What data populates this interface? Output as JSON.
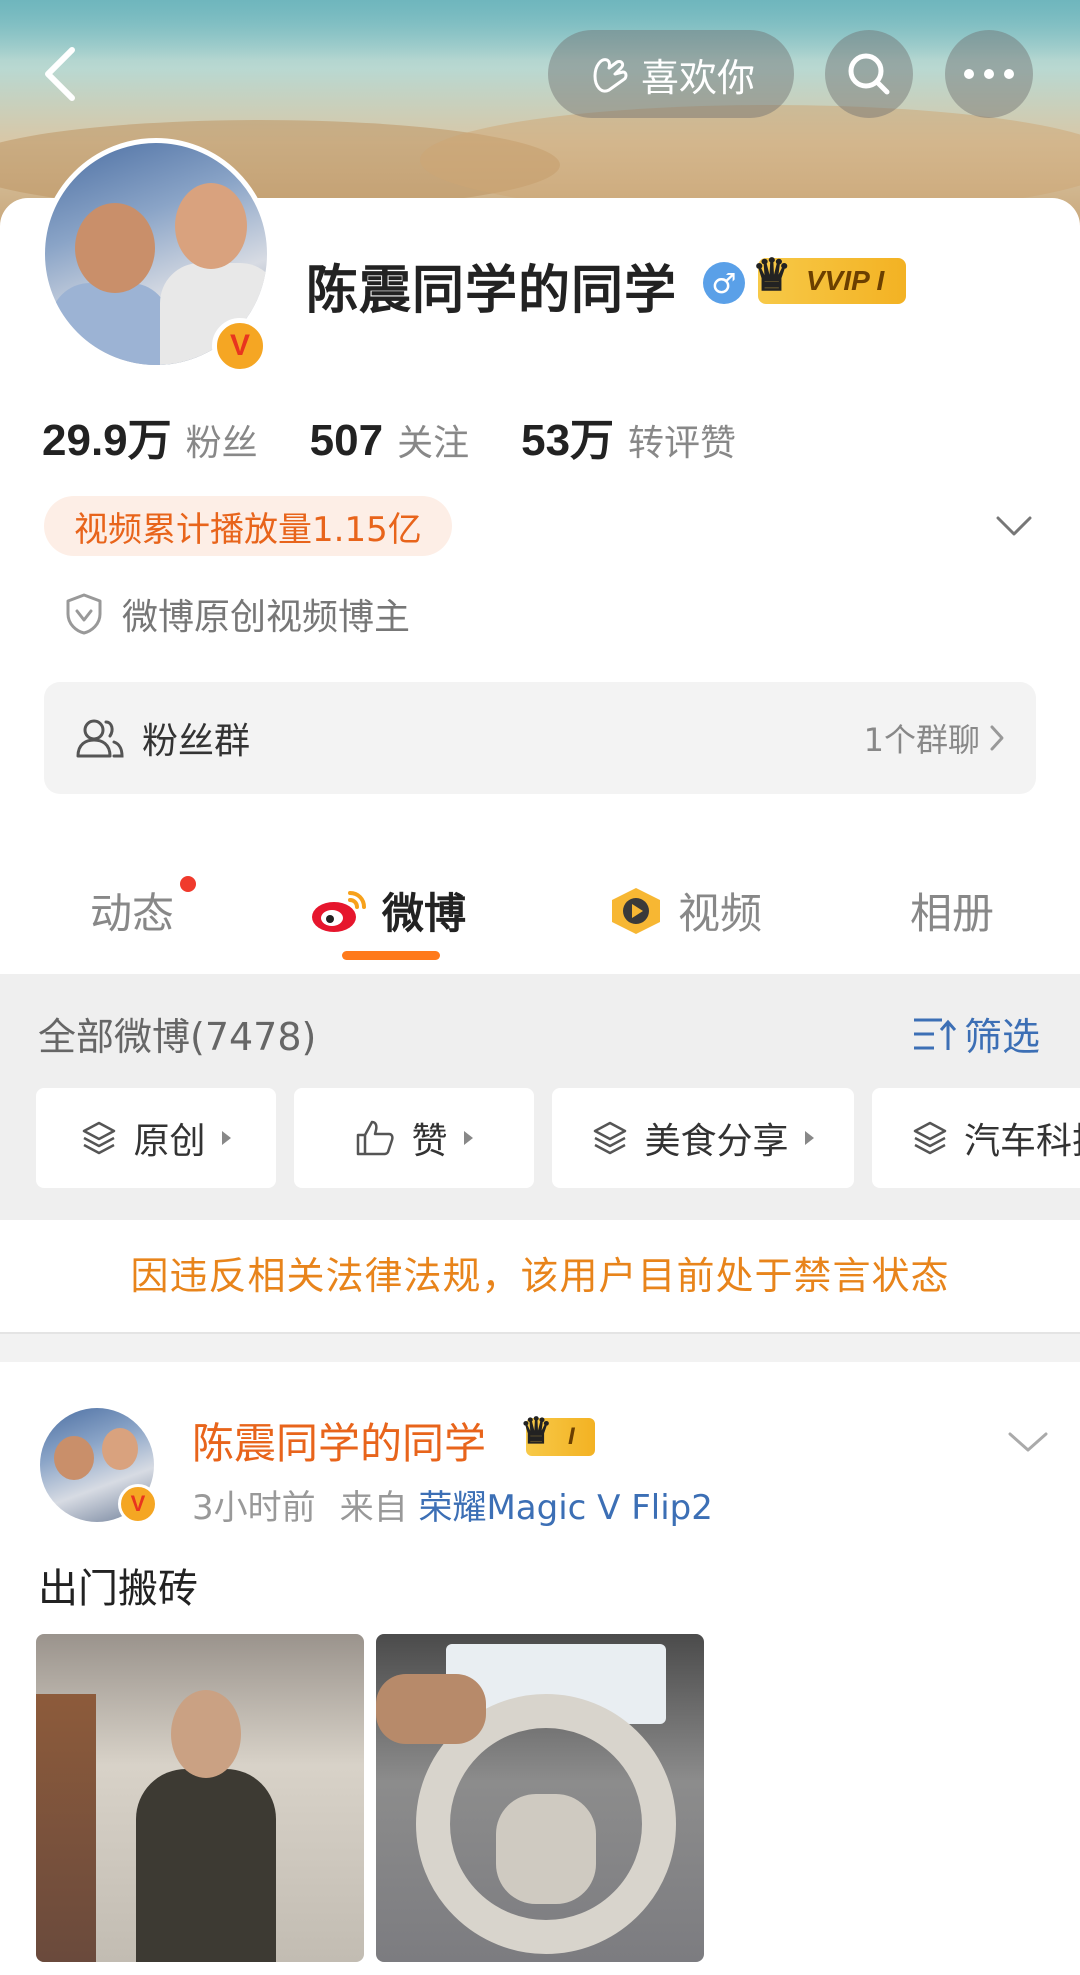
{
  "header": {
    "like_label": "喜欢你"
  },
  "profile": {
    "name": "陈震同学的同学",
    "gender_symbol": "♂",
    "vip_label": "VVIP I",
    "verified_badge": "V",
    "stats": [
      {
        "value": "29.9万",
        "label": "粉丝"
      },
      {
        "value": "507",
        "label": "关注"
      },
      {
        "value": "53万",
        "label": "转评赞"
      }
    ],
    "play_count": "视频累计播放量1.15亿",
    "certification": "微博原创视频博主",
    "fans_group": {
      "title": "粉丝群",
      "count": "1个群聊"
    }
  },
  "tabs": [
    {
      "label": "动态",
      "has_dot": true
    },
    {
      "label": "微博",
      "active": true
    },
    {
      "label": "视频"
    },
    {
      "label": "相册"
    }
  ],
  "feed": {
    "all_label": "全部微博(7478)",
    "filter_label": "筛选",
    "chips": [
      "原创",
      "赞",
      "美食分享",
      "汽车科技"
    ],
    "ban_notice": "因违反相关法律法规，该用户目前处于禁言状态"
  },
  "post": {
    "author": "陈震同学的同学",
    "vip_label": "I",
    "time": "3小时前",
    "source_prefix": "来自",
    "source": "荣耀Magic V Flip2",
    "text": "出门搬砖"
  },
  "colors": {
    "accent_orange": "#ff7a1b",
    "link_blue": "#3c6fb5",
    "notice_orange": "#e8841b"
  }
}
